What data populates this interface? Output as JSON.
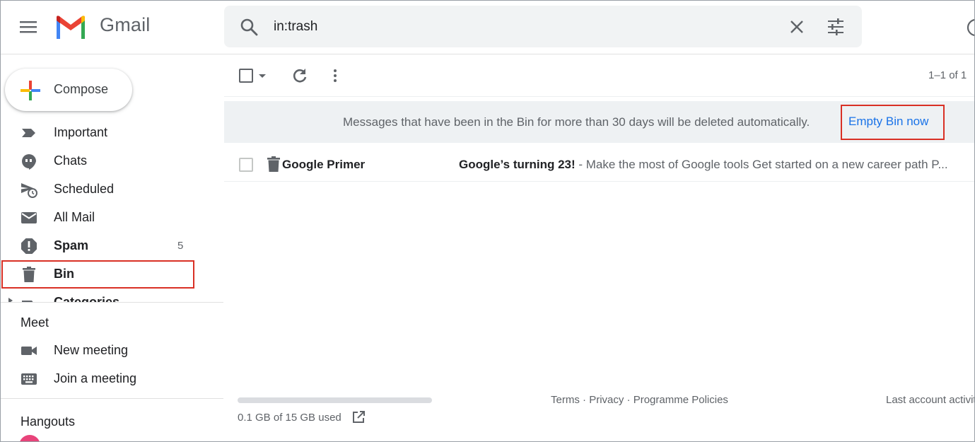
{
  "header": {
    "app_name": "Gmail",
    "search_value": "in:trash"
  },
  "sidebar": {
    "compose_label": "Compose",
    "items": [
      {
        "label": "Important",
        "icon": "important-icon"
      },
      {
        "label": "Chats",
        "icon": "chat-icon"
      },
      {
        "label": "Scheduled",
        "icon": "scheduled-icon"
      },
      {
        "label": "All Mail",
        "icon": "mail-icon"
      },
      {
        "label": "Spam",
        "icon": "spam-icon",
        "count": "5"
      },
      {
        "label": "Bin",
        "icon": "trash-icon",
        "selected": true
      },
      {
        "label": "Categories",
        "icon": "label-icon"
      }
    ],
    "meet": {
      "title": "Meet",
      "new_meeting": "New meeting",
      "join_meeting": "Join a meeting"
    },
    "hangouts_title": "Hangouts"
  },
  "toolbar": {
    "pager": "1–1 of 1"
  },
  "banner": {
    "message": "Messages that have been in the Bin for more than 30 days will be deleted automatically.",
    "action": "Empty Bin now"
  },
  "messages": [
    {
      "sender": "Google Primer",
      "subject": "Google’s turning 23!",
      "snippet": " - Make the most of Google tools Get started on a new career path P..."
    }
  ],
  "footer": {
    "storage": "0.1 GB of 15 GB used",
    "terms": "Terms",
    "privacy": "Privacy",
    "policies": "Programme Policies",
    "separator": " · ",
    "last_activity": "Last account activity"
  },
  "colors": {
    "highlight_border": "#d93025",
    "link": "#1a73e8",
    "banner_bg": "#eef1f3"
  }
}
